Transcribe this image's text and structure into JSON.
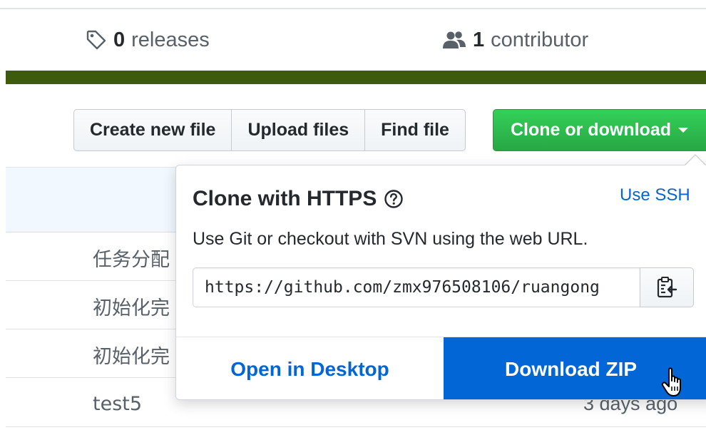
{
  "summary": {
    "releases_count": "0",
    "releases_label": "releases",
    "contributors_count": "1",
    "contributors_label": "contributor"
  },
  "language_bar_color": "#3e5a0c",
  "toolbar": {
    "create_new_file": "Create new file",
    "upload_files": "Upload files",
    "find_file": "Find file",
    "clone_or_download": "Clone or download"
  },
  "commits": [
    {
      "message": "任务分配"
    },
    {
      "message": "初始化完"
    },
    {
      "message": "初始化完"
    },
    {
      "message": "test5",
      "age": "3 days ago"
    }
  ],
  "clone_dropdown": {
    "title": "Clone with HTTPS",
    "use_ssh": "Use SSH",
    "description": "Use Git or checkout with SVN using the web URL.",
    "url": "https://github.com/zmx976508106/ruangong",
    "open_in_desktop": "Open in Desktop",
    "download_zip": "Download ZIP"
  },
  "colors": {
    "accent_green": "#28a745",
    "link_blue": "#0366d6"
  },
  "icons": {
    "releases": "tag-icon",
    "contributors": "people-icon",
    "help": "question-icon",
    "copy": "clipboard-icon",
    "cursor": "hand-pointer-icon"
  }
}
